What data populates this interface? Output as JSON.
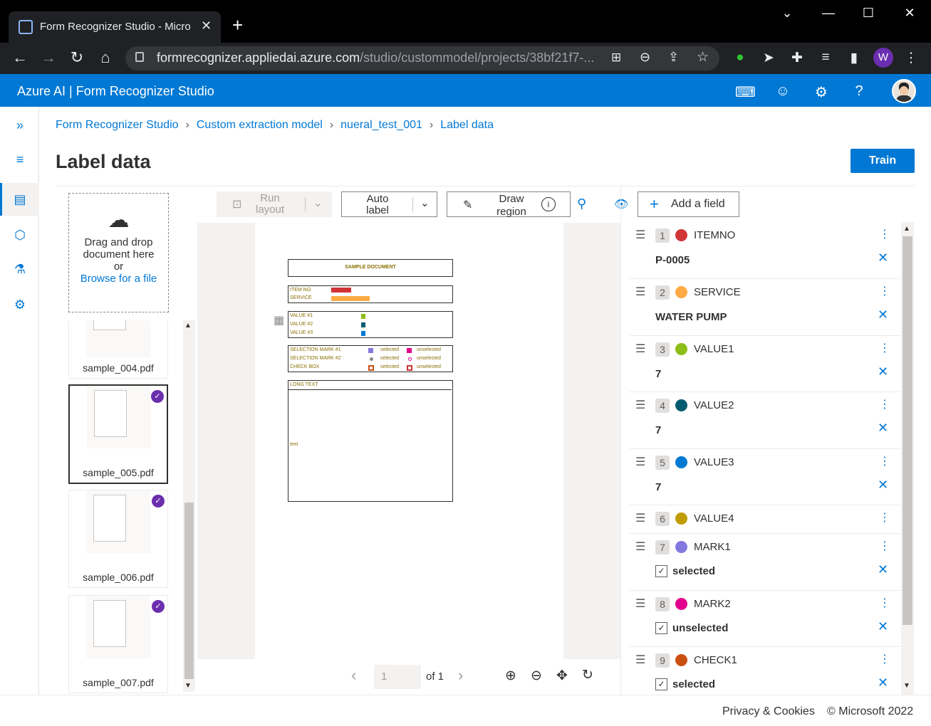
{
  "browser": {
    "tab_title": "Form Recognizer Studio - Micro",
    "url_host": "formrecognizer.appliedai.azure.com",
    "url_path": "/studio/custommodel/projects/38bf21f7-...",
    "profile_initial": "W"
  },
  "app": {
    "brand": "Azure AI | Form Recognizer Studio"
  },
  "breadcrumb": [
    "Form Recognizer Studio",
    "Custom extraction model",
    "nueral_test_001",
    "Label data"
  ],
  "page": {
    "title": "Label data",
    "train_label": "Train"
  },
  "drop": {
    "line1": "Drag and drop",
    "line2": "document here",
    "line3": "or",
    "browse": "Browse for a file"
  },
  "files": [
    {
      "name": "sample_004.pdf"
    },
    {
      "name": "sample_005.pdf"
    },
    {
      "name": "sample_006.pdf"
    },
    {
      "name": "sample_007.pdf"
    }
  ],
  "toolbar": {
    "run_layout_1": "Run",
    "run_layout_2": "layout",
    "auto_label_1": "Auto",
    "auto_label_2": "label",
    "draw_region_1": "Draw",
    "draw_region_2": "region"
  },
  "document": {
    "heading": "SAMPLE DOCUMENT",
    "item_no": "ITEM NO.",
    "service": "SERVICE",
    "value1": "VALUE #1",
    "value2": "VALUE #2",
    "value3": "VALUE #3",
    "mark1": "SELECTION MARK #1",
    "mark2": "SELECTION MARK #2",
    "check": "CHECK BOX",
    "selected": "selected",
    "unselected": "unselected",
    "long_text": "LONG TEXT",
    "text": "text"
  },
  "pager": {
    "current": "1",
    "of": "of 1"
  },
  "fields_panel": {
    "add_label": "Add a field"
  },
  "fields": [
    {
      "num": "1",
      "name": "ITEMNO",
      "color": "#d13438",
      "value": "P-0005"
    },
    {
      "num": "2",
      "name": "SERVICE",
      "color": "#ffaa44",
      "value": "WATER PUMP"
    },
    {
      "num": "3",
      "name": "VALUE1",
      "color": "#8cbd18",
      "value": "7"
    },
    {
      "num": "4",
      "name": "VALUE2",
      "color": "#005b70",
      "value": "7"
    },
    {
      "num": "5",
      "name": "VALUE3",
      "color": "#0078d4",
      "value": "7"
    },
    {
      "num": "6",
      "name": "VALUE4",
      "color": "#c19c00"
    },
    {
      "num": "7",
      "name": "MARK1",
      "color": "#8378de",
      "value": "selected"
    },
    {
      "num": "8",
      "name": "MARK2",
      "color": "#e3008c",
      "value": "unselected"
    },
    {
      "num": "9",
      "name": "CHECK1",
      "color": "#ca5010",
      "value": "selected"
    }
  ],
  "footer": {
    "privacy": "Privacy & Cookies",
    "copyright": "© Microsoft 2022"
  }
}
